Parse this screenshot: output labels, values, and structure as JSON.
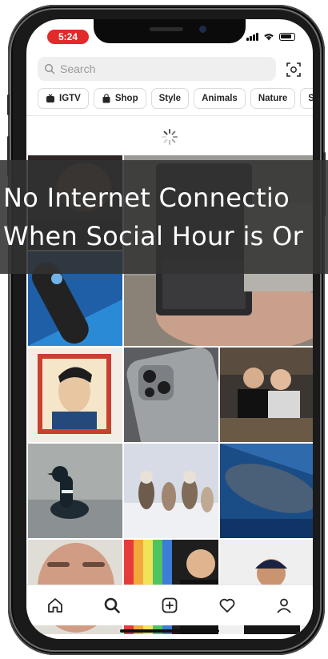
{
  "status_bar": {
    "time": "5:24"
  },
  "search": {
    "placeholder": "Search"
  },
  "categories": [
    {
      "label": "IGTV",
      "icon": "igtv-icon"
    },
    {
      "label": "Shop",
      "icon": "shop-bag-icon"
    },
    {
      "label": "Style"
    },
    {
      "label": "Animals"
    },
    {
      "label": "Nature"
    },
    {
      "label": "S"
    }
  ],
  "overlay": {
    "line1": "No Internet Connectio",
    "line2": "When Social Hour is Or"
  },
  "colors": {
    "time_pill": "#e32a2a",
    "overlay_bg": "#323232",
    "chip_border": "#dbdbdb"
  },
  "grid_tiles": [
    "person-photo-dark",
    "phone-closeup-photo",
    "tv-remote-photo",
    "sketch-portrait-stamp-photo",
    "iphone-back-camera-photo",
    "two-friends-selfie-photo",
    "loon-bird-photo",
    "husky-dogs-photo",
    "whale-underwater-photo",
    "man-face-selfie-photo",
    "rainbow-bokeh-photo",
    "man-cap-portrait-photo"
  ],
  "bottom_nav": [
    "home-icon",
    "search-icon",
    "new-post-icon",
    "activity-heart-icon",
    "profile-icon"
  ]
}
